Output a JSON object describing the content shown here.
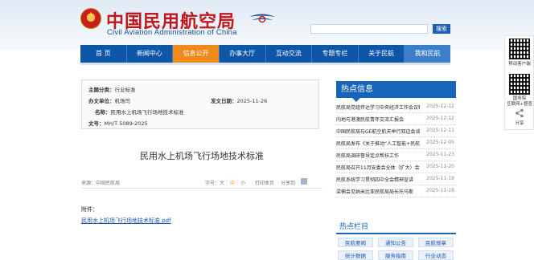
{
  "header": {
    "title_cn": "中国民用航空局",
    "title_en": "Civil Aviation Administration of China",
    "search": {
      "placeholder": "",
      "button_label": "搜索"
    }
  },
  "nav": {
    "items": [
      {
        "label": "首 页"
      },
      {
        "label": "新闻中心"
      },
      {
        "label": "信息公开",
        "active": true
      },
      {
        "label": "办事大厅"
      },
      {
        "label": "互动交流"
      },
      {
        "label": "专题专栏"
      },
      {
        "label": "关于民航"
      },
      {
        "label": "我和民航"
      }
    ]
  },
  "article": {
    "meta": {
      "category_label": "主题分类：",
      "category_value": "行业标准",
      "issuer_label": "办文单位：",
      "issuer_value": "机场司",
      "date_label": "发文日期：",
      "date_value": "2025-11-26",
      "name_label": "名称：",
      "name_value": "民用水上机场飞行场地技术标准",
      "docno_label": "文号：",
      "docno_value": "MH/T 5089-2025"
    },
    "title": "民用水上机场飞行场地技术标准",
    "source": "来源：中国民航局",
    "font_size_label": "字号：",
    "font_sizes": [
      "大",
      "中",
      "小"
    ],
    "print_label": "打印本页",
    "share_label": "分享到",
    "attachment_label": "附件：",
    "attachment_link": "民用水上机场飞行场地技术标准.pdf"
  },
  "hot_info": {
    "heading": "热点信息",
    "items": [
      {
        "title": "民航局党组传达学习中央经济工作会议精神",
        "date": "2025-12-12"
      },
      {
        "title": "内地与港澳民航青年交流汇报会",
        "date": "2025-12-12"
      },
      {
        "title": "中国民航局与GE航空航天举行双边会谈",
        "date": "2025-12-11"
      },
      {
        "title": "民航局发布《关于推动“人工智能+民航”》",
        "date": "2025-12-05"
      },
      {
        "title": "民航局调研督导定点帮扶工作",
        "date": "2025-11-23"
      },
      {
        "title": "民航局召开11月安委会全体（扩大）会议",
        "date": "2025-11-20"
      },
      {
        "title": "民航系统学习贯彻四中全会精神宣讲",
        "date": "2025-11-19"
      },
      {
        "title": "梁楠会见纳米比亚民航局局长托马斯",
        "date": "2025-11-18"
      }
    ]
  },
  "hot_columns": {
    "heading": "热点栏目",
    "buttons": [
      "民航要闻",
      "通知公告",
      "民航规章",
      "统计数据",
      "服务指南",
      "行业动态"
    ]
  },
  "side": {
    "app_label": "移动客户端",
    "gov_label_1": "国务院",
    "gov_label_2": "互联网+督查",
    "share_label": "分享"
  },
  "colors": {
    "nav_blue": "#0e57a8",
    "nav_active": "#f08a1c",
    "brand_red": "#c0161c",
    "link_blue": "#1a56b6"
  }
}
